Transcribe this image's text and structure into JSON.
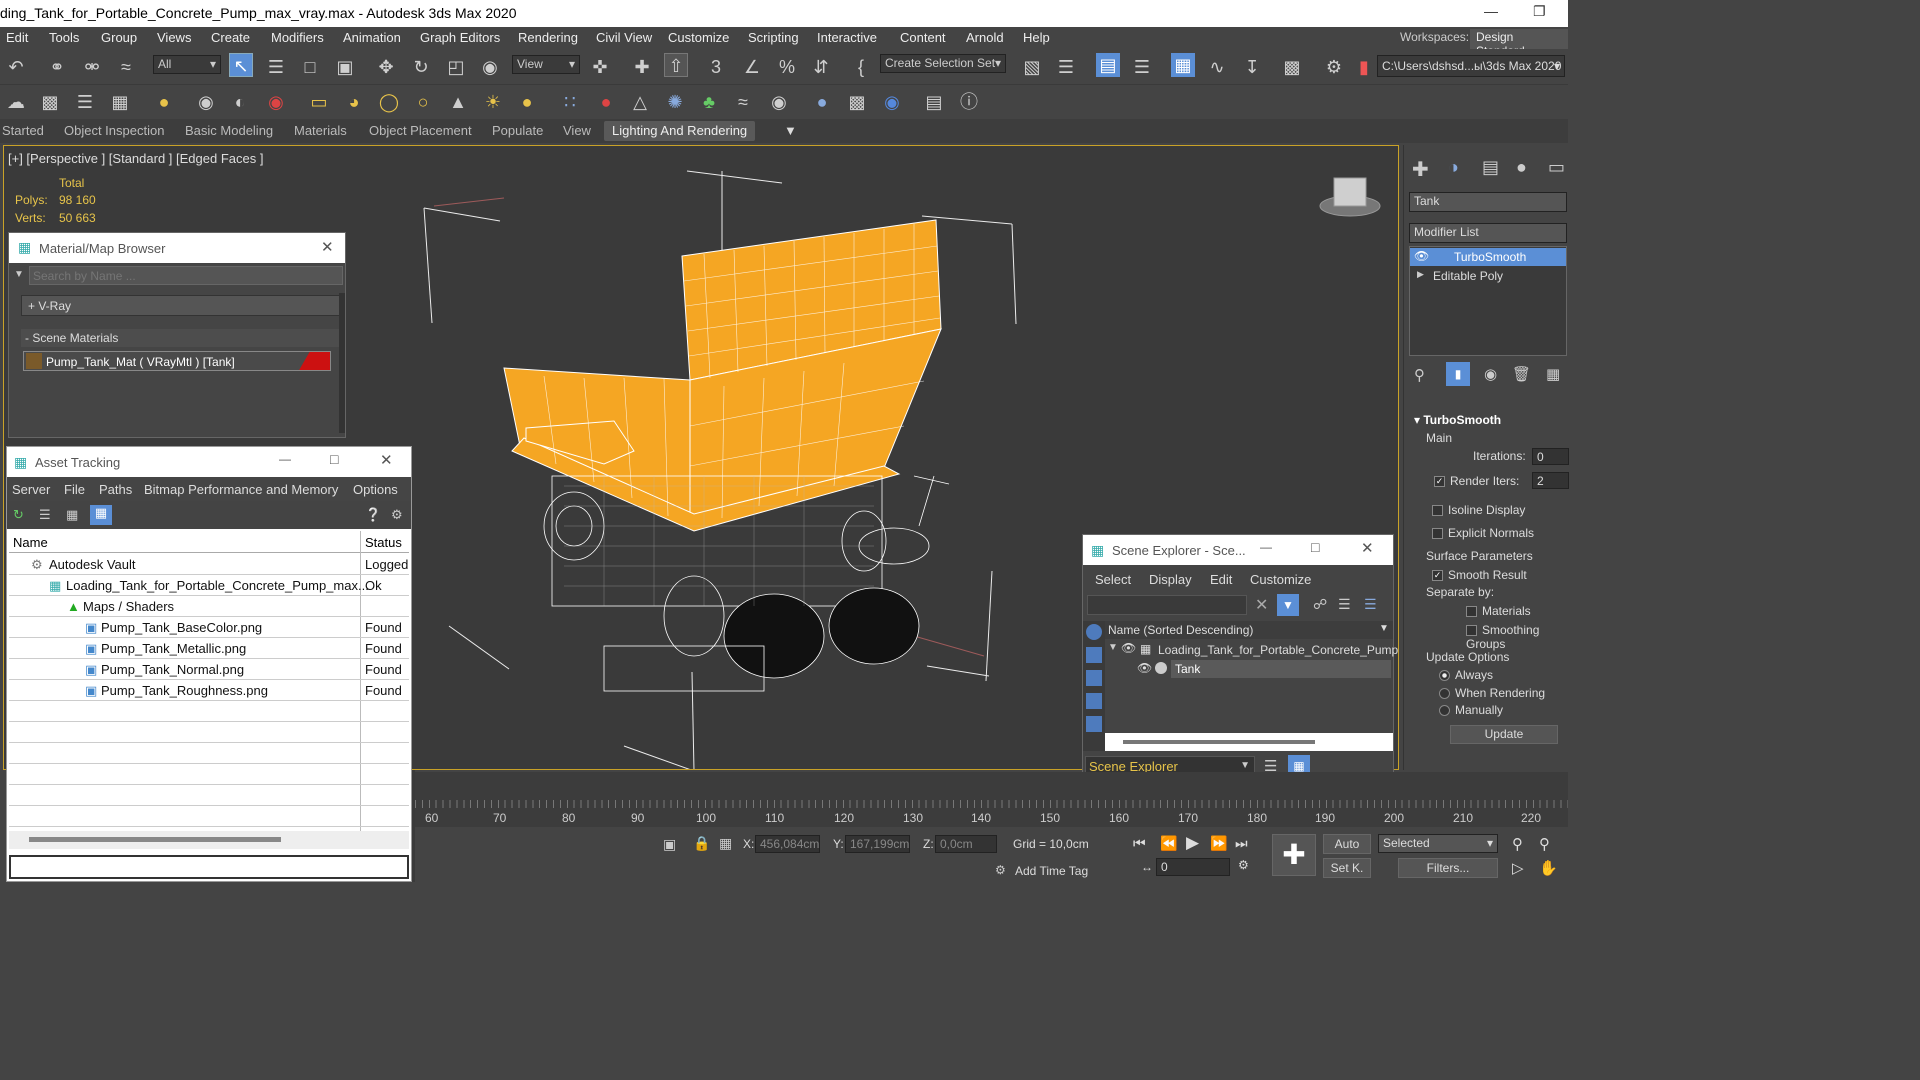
{
  "title": "ding_Tank_for_Portable_Concrete_Pump_max_vray.max - Autodesk 3ds Max 2020",
  "menu": [
    "Edit",
    "Tools",
    "Group",
    "Views",
    "Create",
    "Modifiers",
    "Animation",
    "Graph Editors",
    "Rendering",
    "Civil View",
    "Customize",
    "Scripting",
    "Interactive",
    "Content",
    "Arnold",
    "Help"
  ],
  "workspaces_label": "Workspaces:",
  "workspace_value": "Design Standard",
  "toolbar": {
    "filter": "All",
    "view": "View",
    "selection_set": "Create Selection Set",
    "path": "C:\\Users\\dshsd...ы\\3ds Max 2020"
  },
  "ribbon_tabs": [
    "Started",
    "Object Inspection",
    "Basic Modeling",
    "Materials",
    "Object Placement",
    "Populate",
    "View",
    "Lighting And Rendering"
  ],
  "viewport": {
    "label": "[+] [Perspective ] [Standard ] [Edged Faces ]",
    "total": "Total",
    "polys_label": "Polys:",
    "polys": "98 160",
    "verts_label": "Verts:",
    "verts": "50 663"
  },
  "material_browser": {
    "title": "Material/Map Browser",
    "search_placeholder": "Search by Name ...",
    "vray": "+ V-Ray",
    "scene_materials": "- Scene Materials",
    "material": "Pump_Tank_Mat  ( VRayMtl )  [Tank]"
  },
  "asset_tracking": {
    "title": "Asset Tracking",
    "menu": [
      "Server",
      "File",
      "Paths",
      "Bitmap Performance and Memory",
      "Options"
    ],
    "col_name": "Name",
    "col_status": "Status",
    "rows": [
      {
        "name": "Autodesk Vault",
        "status": "Logged"
      },
      {
        "name": "Loading_Tank_for_Portable_Concrete_Pump_max...",
        "status": "Ok"
      },
      {
        "name": "Maps / Shaders",
        "status": ""
      },
      {
        "name": "Pump_Tank_BaseColor.png",
        "status": "Found"
      },
      {
        "name": "Pump_Tank_Metallic.png",
        "status": "Found"
      },
      {
        "name": "Pump_Tank_Normal.png",
        "status": "Found"
      },
      {
        "name": "Pump_Tank_Roughness.png",
        "status": "Found"
      }
    ]
  },
  "scene_explorer": {
    "title": "Scene Explorer - Sce...",
    "menu": [
      "Select",
      "Display",
      "Edit",
      "Customize"
    ],
    "col": "Name (Sorted Descending)",
    "root": "Loading_Tank_for_Portable_Concrete_Pump",
    "child": "Tank",
    "footer": "Scene Explorer"
  },
  "command_panel": {
    "object_name": "Tank",
    "modifier_list": "Modifier List",
    "stack": [
      "TurboSmooth",
      "Editable Poly"
    ],
    "rollout": "TurboSmooth",
    "main": "Main",
    "iterations_label": "Iterations:",
    "iterations": "0",
    "render_iters_label": "Render Iters:",
    "render_iters": "2",
    "isoline": "Isoline Display",
    "explicit_normals": "Explicit Normals",
    "surface_params": "Surface Parameters",
    "smooth_result": "Smooth Result",
    "separate_by": "Separate by:",
    "materials": "Materials",
    "smoothing_groups": "Smoothing Groups",
    "update_options": "Update Options",
    "always": "Always",
    "when_rendering": "When Rendering",
    "manually": "Manually",
    "update": "Update"
  },
  "timeline_ticks": [
    "60",
    "70",
    "80",
    "90",
    "100",
    "110",
    "120",
    "130",
    "140",
    "150",
    "160",
    "170",
    "180",
    "190",
    "200",
    "210",
    "220"
  ],
  "status": {
    "x_label": "X:",
    "x": "456,084cm",
    "y_label": "Y:",
    "y": "167,199cm",
    "z_label": "Z:",
    "z": "0,0cm",
    "grid": "Grid = 10,0cm",
    "add_time_tag": "Add Time Tag",
    "frame": "0",
    "auto": "Auto",
    "selected": "Selected",
    "set_k": "Set K.",
    "filters": "Filters..."
  }
}
